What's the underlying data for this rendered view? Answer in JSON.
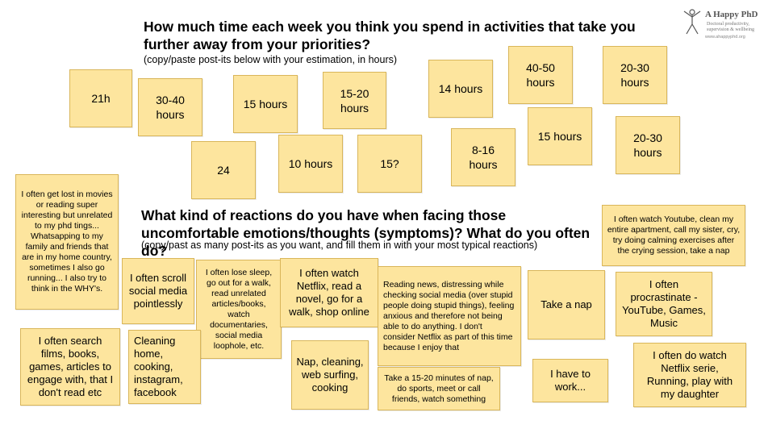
{
  "logo": {
    "name": "A Happy PhD",
    "tagline": "Doctoral productivity,\nsupervision & wellbeing",
    "url": "www.ahappyphd.org"
  },
  "section1": {
    "question": "How much time each week you think you spend in activities that take you further away from your priorities?",
    "hint": "(copy/paste post-its below with your estimation, in hours)",
    "notes": [
      "21h",
      "30-40\nhours",
      "15 hours",
      "15-20\nhours",
      "14 hours",
      "40-50\nhours",
      "20-30\nhours",
      "24",
      "10 hours",
      "15?",
      "8-16\nhours",
      "15 hours",
      "20-30\nhours"
    ]
  },
  "section2": {
    "question": "What kind of reactions do you have when facing those uncomfortable emotions/thoughts (symptoms)? What do you often do?",
    "hint": "(copy/past as many post-its as you want, and fill them in with your most typical reactions)",
    "notes": [
      "I often get lost in movies or reading super interesting but unrelated to my phd tings... Whatsapping to my family and friends that are in my home country, sometimes I also go running... I also try to think in the WHY's.",
      "I often watch Youtube, clean my entire apartment, call my sister, cry, try doing calming exercises after the crying session, take a nap",
      "I often scroll social media pointlessly",
      "I often lose sleep, go out for a walk, read unrelated articles/books, watch documentaries, social media loophole, etc.",
      "I often watch Netflix, read a novel, go for a walk, shop online",
      "Reading news, distressing while checking social media (over stupid people doing stupid things), feeling anxious and therefore not being able to do anything. I don't consider Netflix as part of this time because I enjoy that",
      "Take a nap",
      "I often procrastinate - YouTube, Games, Music",
      "I often search films, books, games, articles to engage with, that I don't read etc",
      "Cleaning home, cooking, instagram, facebook",
      "Nap, cleaning, web surfing, cooking",
      "Take a 15-20 minutes of nap, do sports, meet or call friends, watch something",
      "I have to work...",
      "I often do watch Netflix serie, Running, play with my daughter"
    ]
  }
}
